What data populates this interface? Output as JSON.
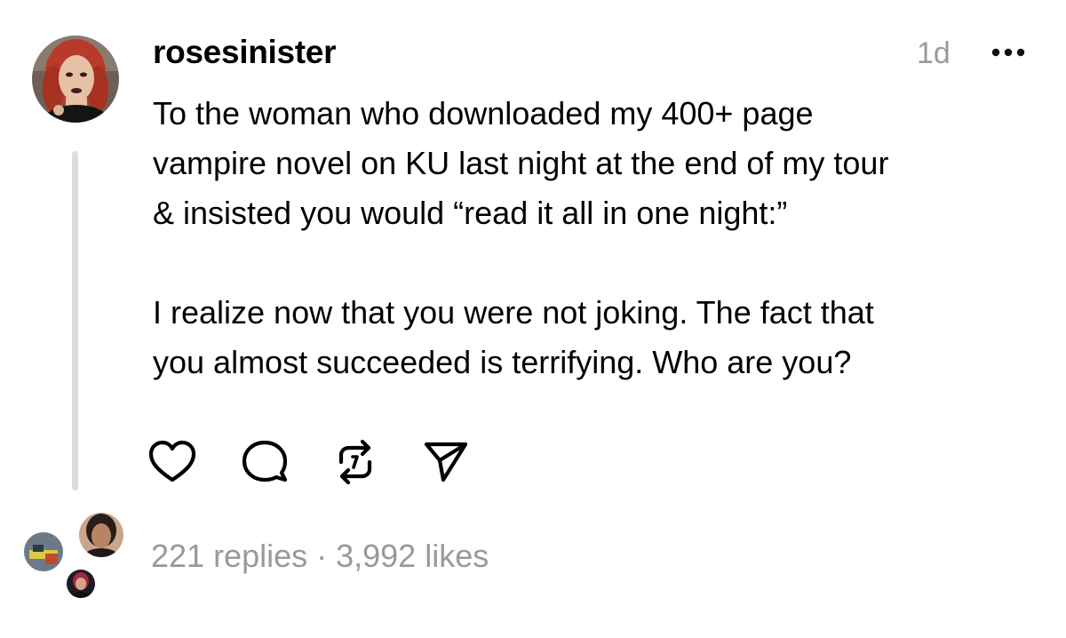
{
  "post": {
    "username": "rosesinister",
    "timestamp": "1d",
    "paragraphs": [
      "To the woman who downloaded my 400+ page\nvampire novel on KU last night at the end of my tour\n& insisted you would “read it all in one night:”",
      "I realize now that you were not joking. The fact that\nyou almost succeeded is terrifying. Who are you?"
    ],
    "stats": "221 replies · 3,992 likes"
  },
  "icons": {
    "more": "more-horizontal-icon",
    "like": "heart-icon",
    "reply": "comment-icon",
    "repost": "repost-icon",
    "share": "send-icon"
  },
  "colors": {
    "text": "#000000",
    "muted": "#999999",
    "thread_line": "#dddddd",
    "avatar_hair": "#b83a2a"
  }
}
